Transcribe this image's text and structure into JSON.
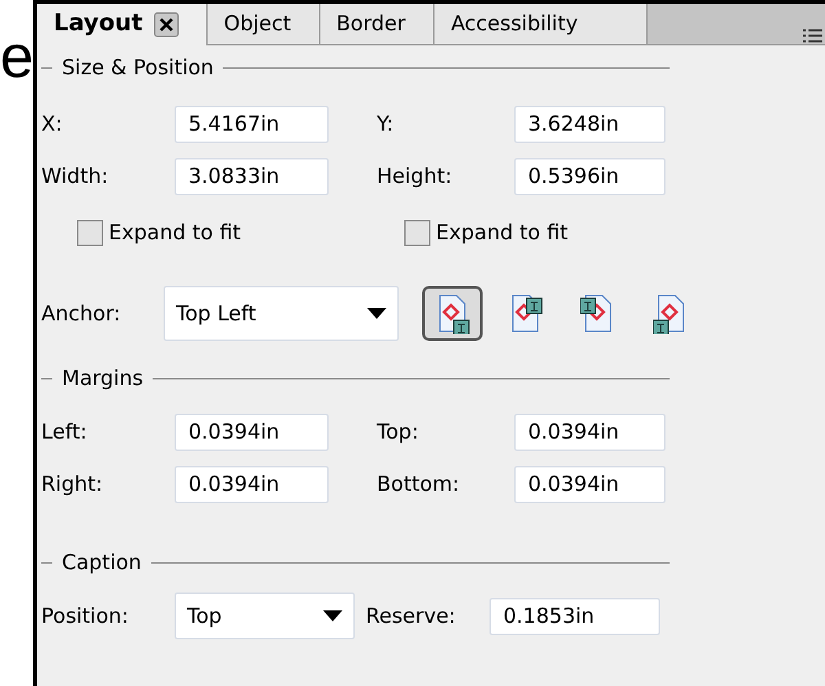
{
  "background_text": "e",
  "tabs": [
    {
      "label": "Layout",
      "selected": true,
      "closable": true
    },
    {
      "label": "Object",
      "selected": false,
      "closable": false
    },
    {
      "label": "Border",
      "selected": false,
      "closable": false
    },
    {
      "label": "Accessibility",
      "selected": false,
      "closable": false
    }
  ],
  "size_position": {
    "title": "Size & Position",
    "rows": [
      {
        "label_1": "X:",
        "value_1": "5.4167in",
        "label_2": "Y:",
        "value_2": "3.6248in"
      },
      {
        "label_1": "Width:",
        "value_1": "3.0833in",
        "label_2": "Height:",
        "value_2": "0.5396in"
      }
    ],
    "checkboxes": [
      {
        "label": "Expand to fit",
        "checked": false
      },
      {
        "label": "Expand to fit",
        "checked": false
      }
    ]
  },
  "anchor": {
    "label": "Anchor:",
    "value": "Top Left",
    "buttons": [
      {
        "selected": true
      },
      {
        "selected": false
      },
      {
        "selected": false
      },
      {
        "selected": false
      }
    ]
  },
  "margins": {
    "title": "Margins",
    "rows": [
      {
        "label_1": "Left:",
        "value_1": "0.0394in",
        "label_2": "Top:",
        "value_2": "0.0394in"
      },
      {
        "label_1": "Right:",
        "value_1": "0.0394in",
        "label_2": "Bottom:",
        "value_2": "0.0394in"
      }
    ]
  },
  "caption": {
    "title": "Caption",
    "position_label": "Position:",
    "position_value": "Top",
    "reserve_label": "Reserve:",
    "reserve_value": "0.1853in"
  }
}
